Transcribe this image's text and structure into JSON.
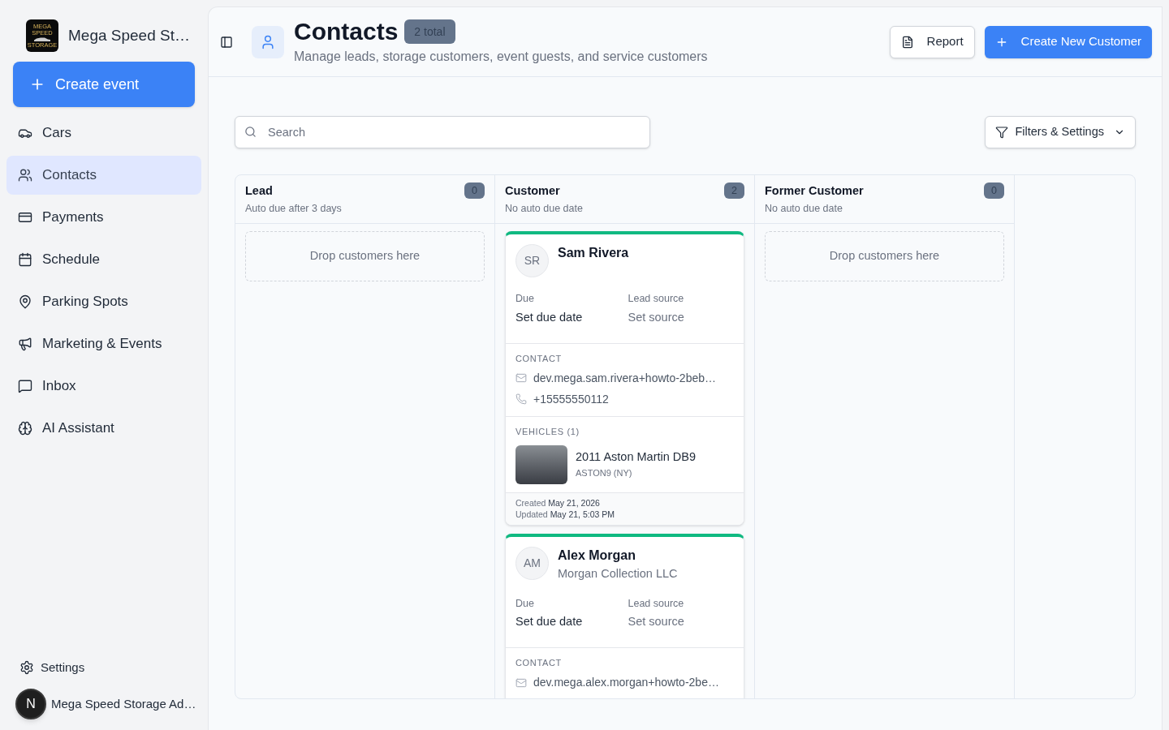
{
  "sidebar": {
    "brand": {
      "logo_lines": [
        "MEGA SPEED",
        "STORAGE"
      ],
      "name": "Mega Speed St…"
    },
    "primary_action": "Create event",
    "items": [
      {
        "label": "Cars",
        "selected": false
      },
      {
        "label": "Contacts",
        "selected": true
      },
      {
        "label": "Payments",
        "selected": false
      },
      {
        "label": "Schedule",
        "selected": false
      },
      {
        "label": "Parking Spots",
        "selected": false
      },
      {
        "label": "Marketing & Events",
        "selected": false
      },
      {
        "label": "Inbox",
        "selected": false
      },
      {
        "label": "AI Assistant",
        "selected": false
      }
    ],
    "settings": "Settings",
    "account": {
      "badge": "N",
      "name": "Mega Speed Storage Ad…"
    }
  },
  "header": {
    "title": "Contacts",
    "count": "2 total",
    "subtitle": "Manage leads, storage customers, event guests, and service customers",
    "buttons": [
      {
        "kind": "outline",
        "label": "Report"
      },
      {
        "kind": "primary",
        "label": "Create New Customer"
      }
    ]
  },
  "toolbar": {
    "search": {
      "placeholder": "Search"
    },
    "filters": "Filters & Settings"
  },
  "board": {
    "columns": [
      {
        "title": "Lead",
        "subtitle": "Auto due after 3 days",
        "count": "0",
        "empty_text": "Drop customers here"
      },
      {
        "title": "Customer",
        "subtitle": "No auto due date",
        "count": "2",
        "cards": [
          {
            "initials": "SR",
            "name": "Sam Rivera",
            "due_label": "Due",
            "due_value": "Set due date",
            "source_label": "Lead source",
            "source_value": "Set source",
            "contact_heading": "CONTACT",
            "email": "dev.mega.sam.rivera+howto-2beb…",
            "phone": "+15555550112",
            "vehicles_heading": "VEHICLES (1)",
            "vehicles": [
              {
                "name": "2011 Aston Martin DB9",
                "plate": "ASTON9 (NY)"
              }
            ],
            "created": {
              "label": "Created",
              "value": "May 21, 2026"
            },
            "updated": {
              "label": "Updated",
              "value": "May 21, 5:03 PM"
            }
          },
          {
            "initials": "AM",
            "name": "Alex Morgan",
            "company": "Morgan Collection LLC",
            "due_label": "Due",
            "due_value": "Set due date",
            "source_label": "Lead source",
            "source_value": "Set source",
            "contact_heading": "CONTACT",
            "email": "dev.mega.alex.morgan+howto-2be…"
          }
        ]
      },
      {
        "title": "Former Customer",
        "subtitle": "No auto due date",
        "count": "0",
        "empty_text": "Drop customers here"
      }
    ]
  }
}
